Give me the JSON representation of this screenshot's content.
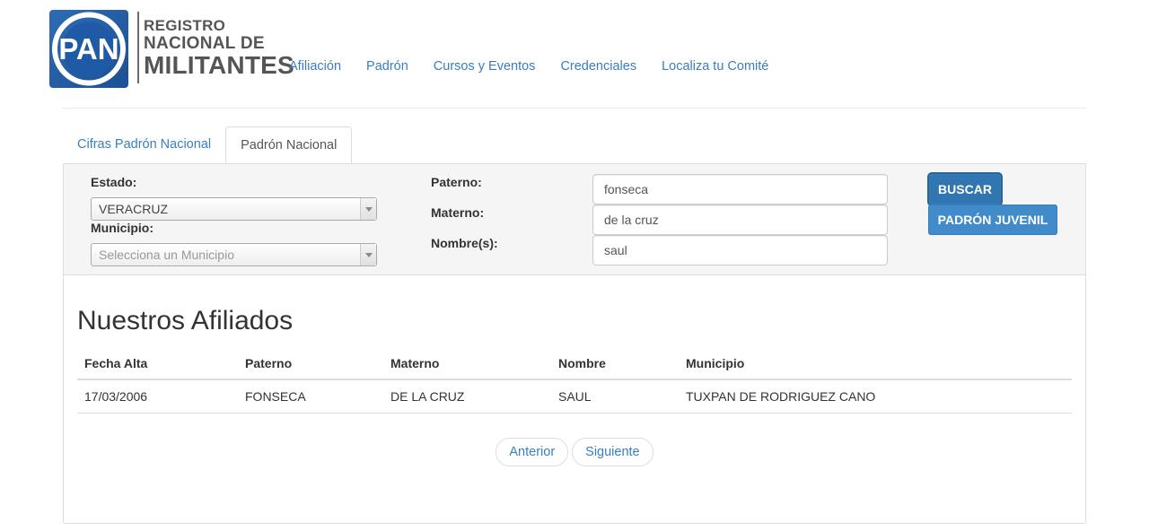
{
  "brand": {
    "logo_text": "PAN",
    "line1": "REGISTRO",
    "line2": "NACIONAL DE",
    "line3": "MILITANTES",
    "color": "#1f5aa6"
  },
  "nav": {
    "items": [
      {
        "label": "Afiliación"
      },
      {
        "label": "Padrón"
      },
      {
        "label": "Cursos y Eventos"
      },
      {
        "label": "Credenciales"
      },
      {
        "label": "Localiza tu Comité"
      }
    ],
    "link_color": "#3a7dbf"
  },
  "tabs": [
    {
      "label": "Cifras Padrón Nacional",
      "active": false
    },
    {
      "label": "Padrón Nacional",
      "active": true
    }
  ],
  "filters": {
    "estado_label": "Estado:",
    "estado_value": "VERACRUZ",
    "municipio_label": "Municipio:",
    "municipio_placeholder": "Selecciona un Municipio",
    "paterno_label": "Paterno:",
    "paterno_value": "fonseca",
    "materno_label": "Materno:",
    "materno_value": "de la cruz",
    "nombre_label": "Nombre(s):",
    "nombre_value": "saul",
    "buscar_label": "BUSCAR",
    "juvenil_label": "PADRÓN JUVENIL",
    "button_color": "#428bca"
  },
  "results": {
    "title": "Nuestros Afiliados",
    "columns": [
      "Fecha Alta",
      "Paterno",
      "Materno",
      "Nombre",
      "Municipio"
    ],
    "rows": [
      [
        "17/03/2006",
        "FONSECA",
        "DE LA CRUZ",
        "SAUL",
        "TUXPAN DE RODRIGUEZ CANO"
      ]
    ]
  },
  "pager": {
    "prev_label": "Anterior",
    "next_label": "Siguiente"
  }
}
